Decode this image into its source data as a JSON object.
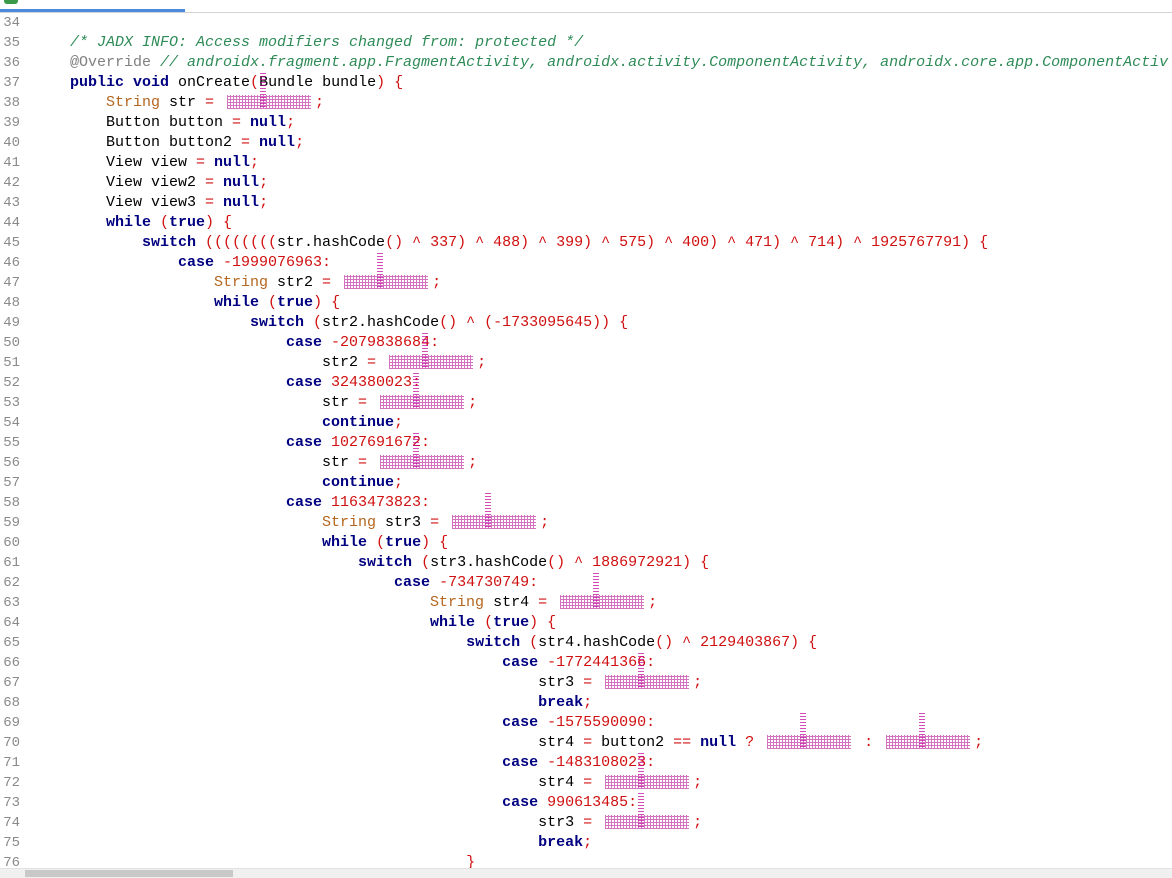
{
  "colors": {
    "keyword": "#000080",
    "comment": "#2e8b57",
    "annotation": "#808080",
    "type": "#b5651d",
    "punct": "#d01010",
    "obfuscated": "#b0008c",
    "tab_accent": "#4a89dc"
  },
  "code": {
    "lines": [
      {
        "num": "34",
        "indent": 0,
        "tokens": []
      },
      {
        "num": "35",
        "indent": 0,
        "tokens": [
          [
            "c",
            "/* JADX INFO: Access modifiers changed from: protected */"
          ]
        ]
      },
      {
        "num": "36",
        "indent": 0,
        "tokens": [
          [
            "a",
            "@Override "
          ],
          [
            "c",
            "// androidx.fragment.app.FragmentActivity, androidx.activity.ComponentActivity, androidx.core.app.ComponentActiv"
          ]
        ]
      },
      {
        "num": "37",
        "indent": 0,
        "tokens": [
          [
            "k",
            "public void "
          ],
          [
            "n",
            "onCreate"
          ],
          [
            "p",
            "("
          ],
          [
            "n",
            "Bundle bundle"
          ],
          [
            "p",
            ") {"
          ]
        ]
      },
      {
        "num": "38",
        "indent": 1,
        "tokens": [
          [
            "y",
            "String "
          ],
          [
            "n",
            "str "
          ],
          [
            "p",
            "= "
          ],
          [
            "s"
          ],
          [
            "p",
            ";"
          ]
        ]
      },
      {
        "num": "39",
        "indent": 1,
        "tokens": [
          [
            "n",
            "Button button "
          ],
          [
            "p",
            "= "
          ],
          [
            "k",
            "null"
          ],
          [
            "p",
            ";"
          ]
        ]
      },
      {
        "num": "40",
        "indent": 1,
        "tokens": [
          [
            "n",
            "Button button2 "
          ],
          [
            "p",
            "= "
          ],
          [
            "k",
            "null"
          ],
          [
            "p",
            ";"
          ]
        ]
      },
      {
        "num": "41",
        "indent": 1,
        "tokens": [
          [
            "n",
            "View view "
          ],
          [
            "p",
            "= "
          ],
          [
            "k",
            "null"
          ],
          [
            "p",
            ";"
          ]
        ]
      },
      {
        "num": "42",
        "indent": 1,
        "tokens": [
          [
            "n",
            "View view2 "
          ],
          [
            "p",
            "= "
          ],
          [
            "k",
            "null"
          ],
          [
            "p",
            ";"
          ]
        ]
      },
      {
        "num": "43",
        "indent": 1,
        "tokens": [
          [
            "n",
            "View view3 "
          ],
          [
            "p",
            "= "
          ],
          [
            "k",
            "null"
          ],
          [
            "p",
            ";"
          ]
        ]
      },
      {
        "num": "44",
        "indent": 1,
        "tokens": [
          [
            "k",
            "while "
          ],
          [
            "p",
            "("
          ],
          [
            "k",
            "true"
          ],
          [
            "p",
            ") {"
          ]
        ]
      },
      {
        "num": "45",
        "indent": 2,
        "tokens": [
          [
            "k",
            "switch "
          ],
          [
            "p",
            "(((((((("
          ],
          [
            "n",
            "str.hashCode"
          ],
          [
            "p",
            "() ^ 337) ^ 488) ^ 399) ^ 575) ^ 400) ^ 471) ^ 714) ^ 1925767791) {"
          ]
        ]
      },
      {
        "num": "46",
        "indent": 3,
        "tokens": [
          [
            "k",
            "case "
          ],
          [
            "p",
            "-1999076963:"
          ]
        ]
      },
      {
        "num": "47",
        "indent": 4,
        "tokens": [
          [
            "y",
            "String "
          ],
          [
            "n",
            "str2 "
          ],
          [
            "p",
            "= "
          ],
          [
            "s"
          ],
          [
            "p",
            ";"
          ]
        ]
      },
      {
        "num": "48",
        "indent": 4,
        "tokens": [
          [
            "k",
            "while "
          ],
          [
            "p",
            "("
          ],
          [
            "k",
            "true"
          ],
          [
            "p",
            ") {"
          ]
        ]
      },
      {
        "num": "49",
        "indent": 5,
        "tokens": [
          [
            "k",
            "switch "
          ],
          [
            "p",
            "("
          ],
          [
            "n",
            "str2.hashCode"
          ],
          [
            "p",
            "() ^ (-1733095645)) {"
          ]
        ]
      },
      {
        "num": "50",
        "indent": 6,
        "tokens": [
          [
            "k",
            "case "
          ],
          [
            "p",
            "-2079838684:"
          ]
        ]
      },
      {
        "num": "51",
        "indent": 7,
        "tokens": [
          [
            "n",
            "str2 "
          ],
          [
            "p",
            "= "
          ],
          [
            "s"
          ],
          [
            "p",
            ";"
          ]
        ]
      },
      {
        "num": "52",
        "indent": 6,
        "tokens": [
          [
            "k",
            "case "
          ],
          [
            "p",
            "324380023:"
          ]
        ]
      },
      {
        "num": "53",
        "indent": 7,
        "tokens": [
          [
            "n",
            "str "
          ],
          [
            "p",
            "= "
          ],
          [
            "s"
          ],
          [
            "p",
            ";"
          ]
        ]
      },
      {
        "num": "54",
        "indent": 7,
        "tokens": [
          [
            "k",
            "continue"
          ],
          [
            "p",
            ";"
          ]
        ]
      },
      {
        "num": "55",
        "indent": 6,
        "tokens": [
          [
            "k",
            "case "
          ],
          [
            "p",
            "1027691672:"
          ]
        ]
      },
      {
        "num": "56",
        "indent": 7,
        "tokens": [
          [
            "n",
            "str "
          ],
          [
            "p",
            "= "
          ],
          [
            "s"
          ],
          [
            "p",
            ";"
          ]
        ]
      },
      {
        "num": "57",
        "indent": 7,
        "tokens": [
          [
            "k",
            "continue"
          ],
          [
            "p",
            ";"
          ]
        ]
      },
      {
        "num": "58",
        "indent": 6,
        "tokens": [
          [
            "k",
            "case "
          ],
          [
            "p",
            "1163473823:"
          ]
        ]
      },
      {
        "num": "59",
        "indent": 7,
        "tokens": [
          [
            "y",
            "String "
          ],
          [
            "n",
            "str3 "
          ],
          [
            "p",
            "= "
          ],
          [
            "s"
          ],
          [
            "p",
            ";"
          ]
        ]
      },
      {
        "num": "60",
        "indent": 7,
        "tokens": [
          [
            "k",
            "while "
          ],
          [
            "p",
            "("
          ],
          [
            "k",
            "true"
          ],
          [
            "p",
            ") {"
          ]
        ]
      },
      {
        "num": "61",
        "indent": 8,
        "tokens": [
          [
            "k",
            "switch "
          ],
          [
            "p",
            "("
          ],
          [
            "n",
            "str3.hashCode"
          ],
          [
            "p",
            "() ^ 1886972921) {"
          ]
        ]
      },
      {
        "num": "62",
        "indent": 9,
        "tokens": [
          [
            "k",
            "case "
          ],
          [
            "p",
            "-734730749:"
          ]
        ]
      },
      {
        "num": "63",
        "indent": 10,
        "tokens": [
          [
            "y",
            "String "
          ],
          [
            "n",
            "str4 "
          ],
          [
            "p",
            "= "
          ],
          [
            "s"
          ],
          [
            "p",
            ";"
          ]
        ]
      },
      {
        "num": "64",
        "indent": 10,
        "tokens": [
          [
            "k",
            "while "
          ],
          [
            "p",
            "("
          ],
          [
            "k",
            "true"
          ],
          [
            "p",
            ") {"
          ]
        ]
      },
      {
        "num": "65",
        "indent": 11,
        "tokens": [
          [
            "k",
            "switch "
          ],
          [
            "p",
            "("
          ],
          [
            "n",
            "str4.hashCode"
          ],
          [
            "p",
            "() ^ 2129403867) {"
          ]
        ]
      },
      {
        "num": "66",
        "indent": 12,
        "tokens": [
          [
            "k",
            "case "
          ],
          [
            "p",
            "-1772441366:"
          ]
        ]
      },
      {
        "num": "67",
        "indent": 13,
        "tokens": [
          [
            "n",
            "str3 "
          ],
          [
            "p",
            "= "
          ],
          [
            "s"
          ],
          [
            "p",
            ";"
          ]
        ]
      },
      {
        "num": "68",
        "indent": 13,
        "tokens": [
          [
            "k",
            "break"
          ],
          [
            "p",
            ";"
          ]
        ]
      },
      {
        "num": "69",
        "indent": 12,
        "tokens": [
          [
            "k",
            "case "
          ],
          [
            "p",
            "-1575590090:"
          ]
        ]
      },
      {
        "num": "70",
        "indent": 13,
        "tokens": [
          [
            "n",
            "str4 "
          ],
          [
            "p",
            "= "
          ],
          [
            "n",
            "button2 "
          ],
          [
            "p",
            "== "
          ],
          [
            "k",
            "null "
          ],
          [
            "p",
            "? "
          ],
          [
            "s"
          ],
          [
            "p",
            " : "
          ],
          [
            "s"
          ],
          [
            "p",
            ";"
          ]
        ]
      },
      {
        "num": "71",
        "indent": 12,
        "tokens": [
          [
            "k",
            "case "
          ],
          [
            "p",
            "-1483108023:"
          ]
        ]
      },
      {
        "num": "72",
        "indent": 13,
        "tokens": [
          [
            "n",
            "str4 "
          ],
          [
            "p",
            "= "
          ],
          [
            "s"
          ],
          [
            "p",
            ";"
          ]
        ]
      },
      {
        "num": "73",
        "indent": 12,
        "tokens": [
          [
            "k",
            "case "
          ],
          [
            "p",
            "990613485:"
          ]
        ]
      },
      {
        "num": "74",
        "indent": 13,
        "tokens": [
          [
            "n",
            "str3 "
          ],
          [
            "p",
            "= "
          ],
          [
            "s"
          ],
          [
            "p",
            ";"
          ]
        ]
      },
      {
        "num": "75",
        "indent": 13,
        "tokens": [
          [
            "k",
            "break"
          ],
          [
            "p",
            ";"
          ]
        ]
      },
      {
        "num": "76",
        "indent": 11,
        "tokens": [
          [
            "p",
            "}"
          ]
        ]
      }
    ]
  }
}
